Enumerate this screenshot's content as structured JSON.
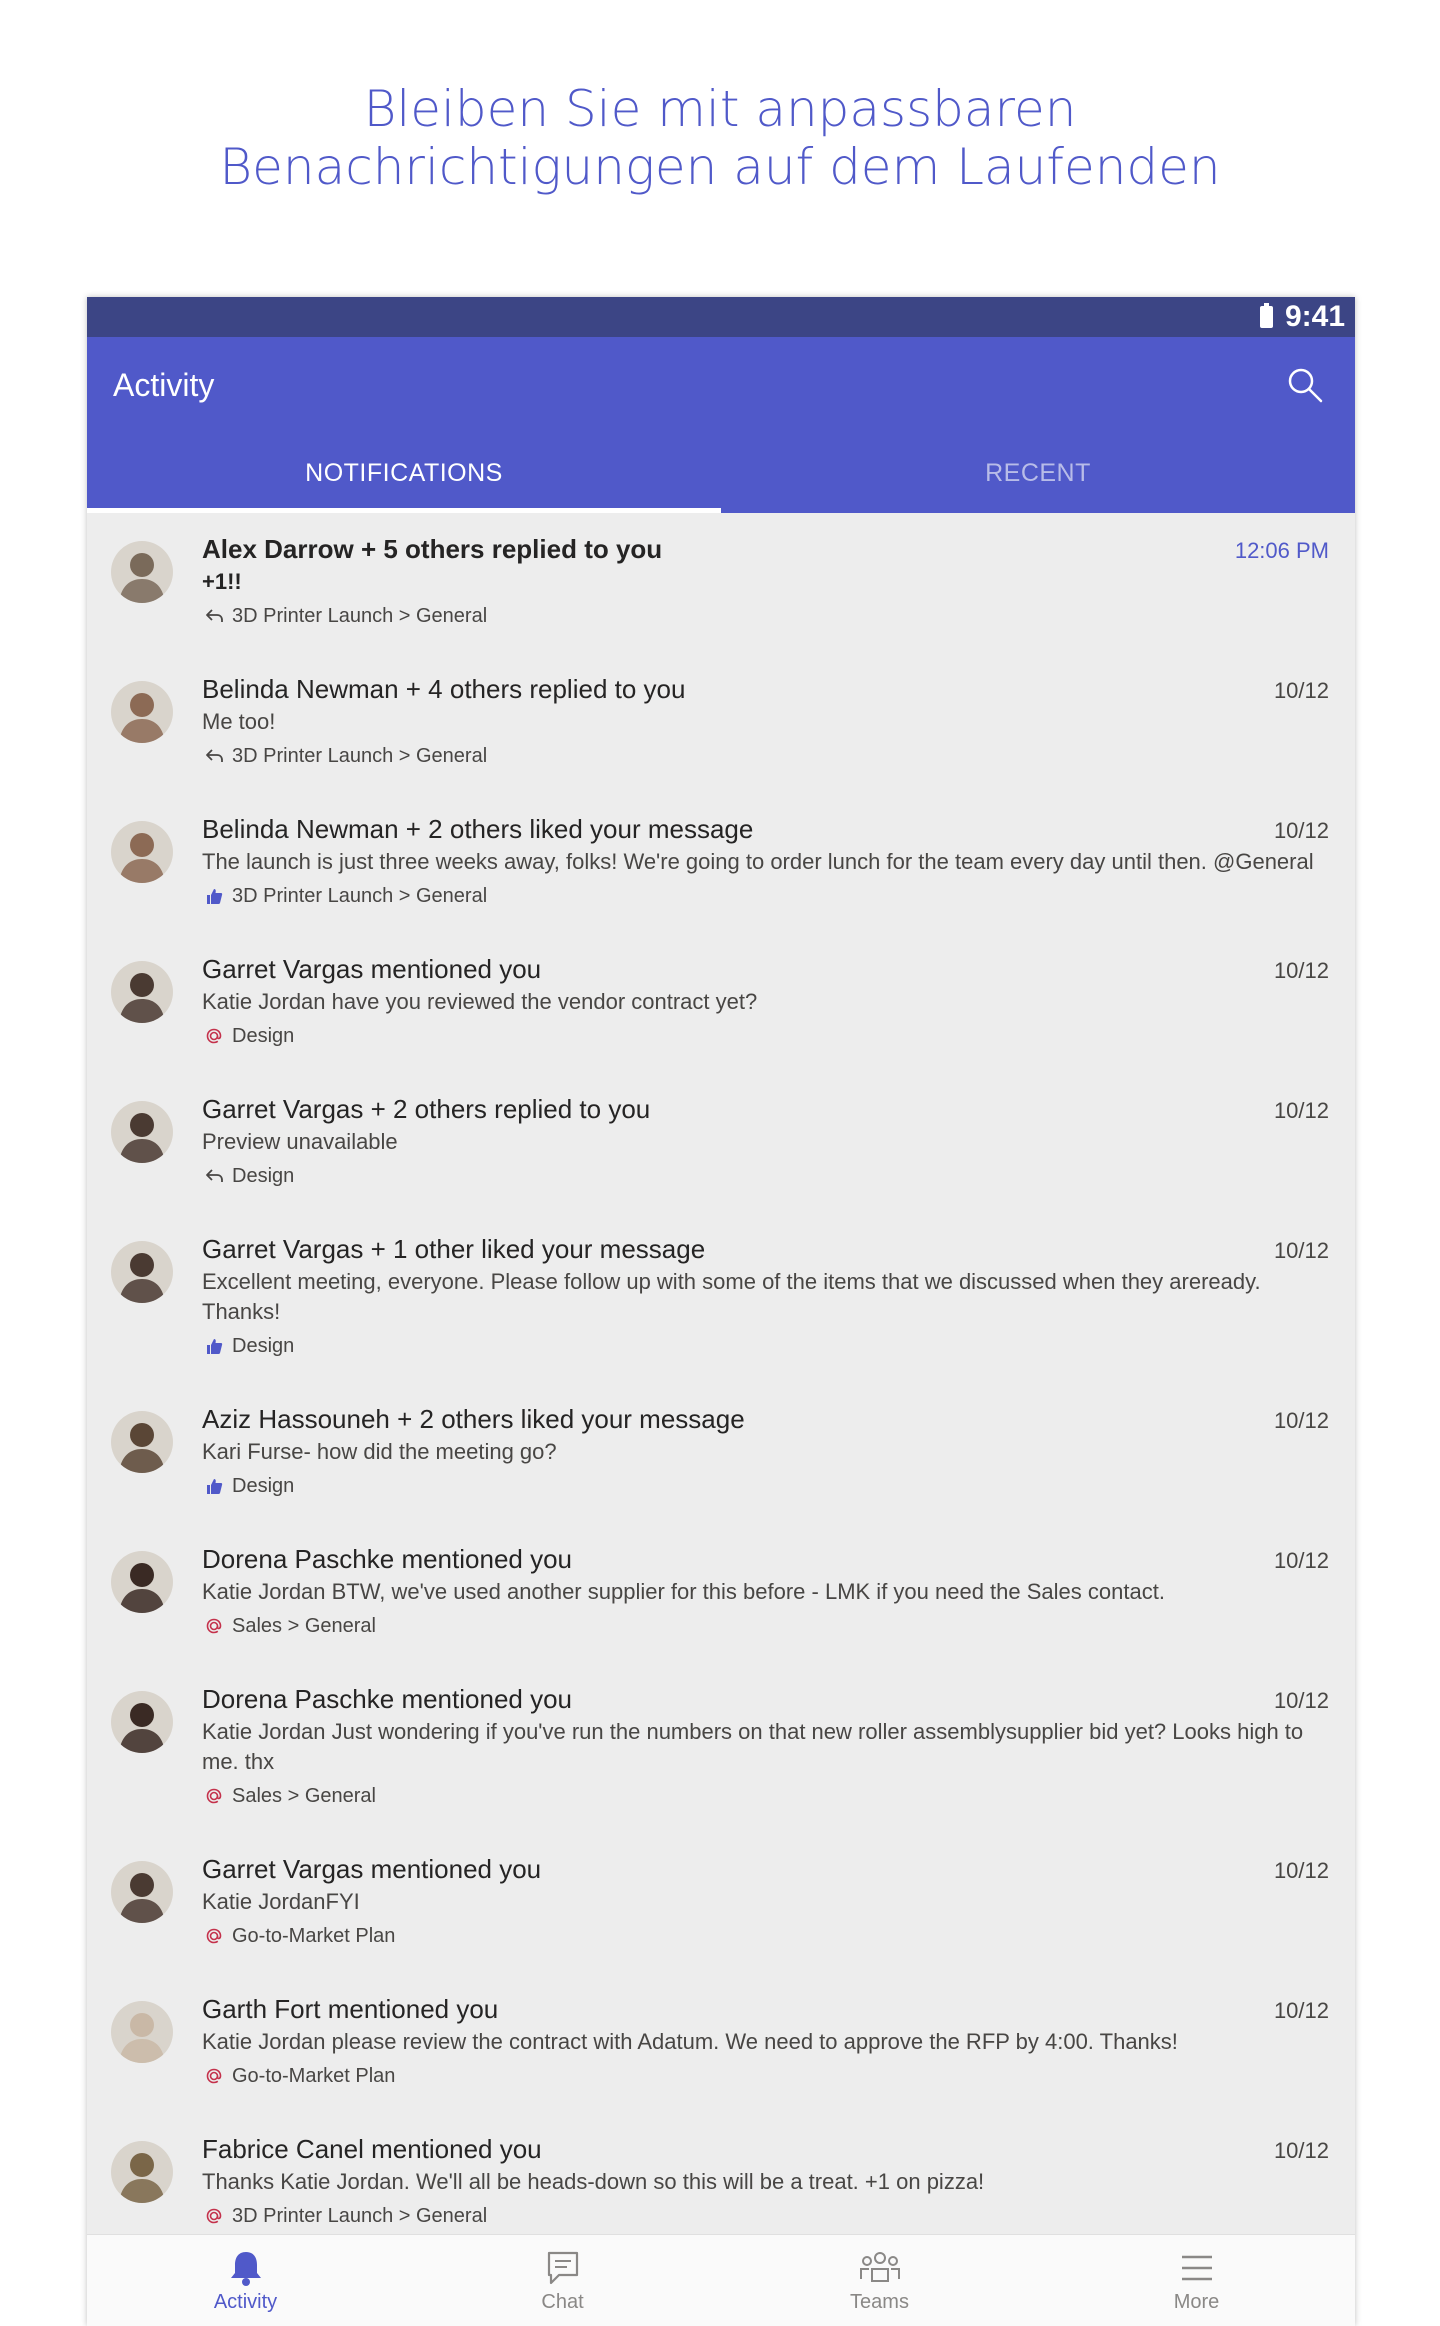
{
  "headline": {
    "line1": "Bleiben Sie mit anpassbaren",
    "line2": "Benachrichtigungen auf dem Laufenden"
  },
  "statusbar": {
    "time": "9:41"
  },
  "appbar": {
    "title": "Activity"
  },
  "tabs": [
    {
      "label": "NOTIFICATIONS",
      "active": true
    },
    {
      "label": "RECENT",
      "active": false
    }
  ],
  "notifications": [
    {
      "title": "Alex Darrow + 5 others replied to you",
      "time": "12:06 PM",
      "body": "+1!!",
      "channel": "3D Printer Launch > General",
      "icon": "reply-icon",
      "avatar_color": "#7a6a5a"
    },
    {
      "title": "Belinda Newman + 4 others replied to you",
      "time": "10/12",
      "body": "Me too!",
      "channel": "3D Printer Launch > General",
      "icon": "reply-icon",
      "avatar_color": "#8c6a55"
    },
    {
      "title": "Belinda Newman + 2 others liked your message",
      "time": "10/12",
      "body": "The launch is just three weeks away, folks! We're going to order lunch for the team every day until then. @General",
      "channel": "3D Printer Launch > General",
      "icon": "like-icon",
      "avatar_color": "#8c6a55"
    },
    {
      "title": "Garret Vargas mentioned you",
      "time": "10/12",
      "body": "Katie Jordan have you reviewed the vendor contract yet?",
      "channel": "Design",
      "icon": "mention-icon",
      "avatar_color": "#4a3a32"
    },
    {
      "title": "Garret Vargas + 2 others replied to you",
      "time": "10/12",
      "body": "Preview unavailable",
      "channel": "Design",
      "icon": "reply-icon",
      "avatar_color": "#4a3a32"
    },
    {
      "title": "Garret Vargas + 1 other liked your message",
      "time": "10/12",
      "body": "Excellent meeting, everyone. Please follow up with some of the items that we discussed when they areready. Thanks!",
      "channel": "Design",
      "icon": "like-icon",
      "avatar_color": "#4a3a32"
    },
    {
      "title": "Aziz Hassouneh + 2 others liked your message",
      "time": "10/12",
      "body": "Kari Furse- how did the meeting go?",
      "channel": "Design",
      "icon": "like-icon",
      "avatar_color": "#5a4636"
    },
    {
      "title": "Dorena Paschke mentioned you",
      "time": "10/12",
      "body": "Katie Jordan  BTW, we've used another supplier for this before - LMK if you need the Sales contact.",
      "channel": "Sales > General",
      "icon": "mention-icon",
      "avatar_color": "#3a2a24"
    },
    {
      "title": "Dorena Paschke mentioned you",
      "time": "10/12",
      "body": "Katie Jordan Just wondering if you've run the numbers on that new roller assemblysupplier bid yet? Looks high to me. thx",
      "channel": "Sales > General",
      "icon": "mention-icon",
      "avatar_color": "#3a2a24"
    },
    {
      "title": "Garret Vargas mentioned you",
      "time": "10/12",
      "body": "Katie JordanFYI",
      "channel": "Go-to-Market Plan",
      "icon": "mention-icon",
      "avatar_color": "#4a3a32"
    },
    {
      "title": "Garth Fort mentioned you",
      "time": "10/12",
      "body": "Katie Jordan please review the contract with Adatum. We need to approve the RFP by 4:00. Thanks!",
      "channel": "Go-to-Market Plan",
      "icon": "mention-icon",
      "avatar_color": "#c9b8a6"
    },
    {
      "title": "Fabrice Canel mentioned you",
      "time": "10/12",
      "body": "Thanks Katie Jordan. We'll all be heads-down so this will be a treat. +1 on pizza!",
      "channel": "3D Printer Launch > General",
      "icon": "mention-icon",
      "avatar_color": "#7a6648"
    }
  ],
  "bottomnav": [
    {
      "label": "Activity",
      "icon": "bell-icon",
      "active": true
    },
    {
      "label": "Chat",
      "icon": "chat-icon",
      "active": false
    },
    {
      "label": "Teams",
      "icon": "teams-icon",
      "active": false
    },
    {
      "label": "More",
      "icon": "more-icon",
      "active": false
    }
  ],
  "colors": {
    "accent": "#5059c9",
    "statusbar": "#3c4585",
    "mention": "#c4314b"
  }
}
